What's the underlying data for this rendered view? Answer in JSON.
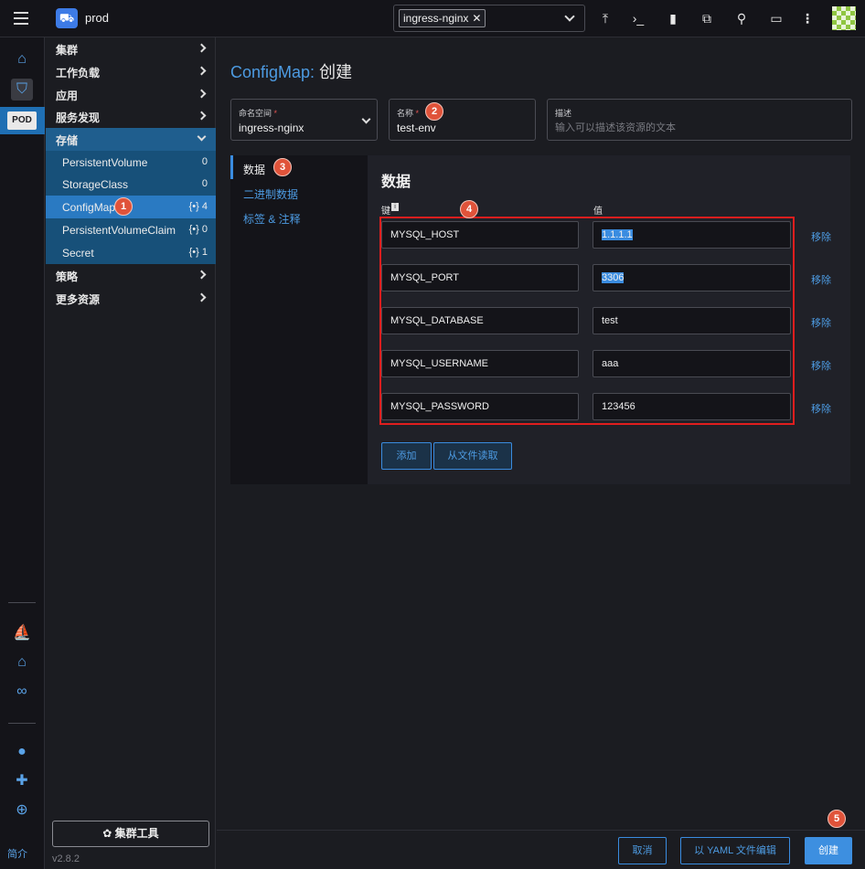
{
  "header": {
    "cluster_name": "prod",
    "namespace_tag": "ingress-nginx",
    "tag_remove": "✕",
    "icons": [
      "upload-icon",
      "terminal-icon",
      "file-icon",
      "copy-icon",
      "search-icon",
      "book-icon",
      "more-icon"
    ]
  },
  "rail": {
    "pod_label": "POD",
    "bottom_label": "简介"
  },
  "nav": {
    "groups": [
      {
        "label": "集群"
      },
      {
        "label": "工作负载"
      },
      {
        "label": "应用"
      },
      {
        "label": "服务发现"
      },
      {
        "label": "存储"
      },
      {
        "label": "策略"
      },
      {
        "label": "更多资源"
      }
    ],
    "storage_items": [
      {
        "label": "PersistentVolume",
        "count": "0"
      },
      {
        "label": "StorageClass",
        "count": "0"
      },
      {
        "label": "ConfigMap",
        "count": "{•} 4"
      },
      {
        "label": "PersistentVolumeClaim",
        "count": "{•} 0"
      },
      {
        "label": "Secret",
        "count": "{•} 1"
      }
    ],
    "cluster_tools": "✿ 集群工具",
    "version": "v2.8.2"
  },
  "main": {
    "title_resource": "ConfigMap:",
    "title_action": "创建",
    "namespace": {
      "label": "命名空间",
      "req": "*",
      "value": "ingress-nginx"
    },
    "name": {
      "label": "名称",
      "req": "*",
      "value": "test-env"
    },
    "description": {
      "label": "描述",
      "placeholder": "输入可以描述该资源的文本"
    },
    "tabs": [
      "数据",
      "二进制数据",
      "标签 & 注释"
    ],
    "section_title": "数据",
    "key_header": "键",
    "info_glyph": "i",
    "value_header": "值",
    "rows": [
      {
        "key": "MYSQL_HOST",
        "value": "1.1.1.1",
        "remove": "移除"
      },
      {
        "key": "MYSQL_PORT",
        "value": "3306",
        "remove": "移除"
      },
      {
        "key": "MYSQL_DATABASE",
        "value": "test",
        "remove": "移除"
      },
      {
        "key": "MYSQL_USERNAME",
        "value": "aaa",
        "remove": "移除"
      },
      {
        "key": "MYSQL_PASSWORD",
        "value": "123456",
        "remove": "移除"
      }
    ],
    "add_button": "添加",
    "read_file_button": "从文件读取"
  },
  "footer": {
    "cancel": "取消",
    "edit_yaml": "以 YAML 文件编辑",
    "create": "创建"
  },
  "badges": [
    "1",
    "2",
    "3",
    "4",
    "5"
  ],
  "colors": {
    "accent": "#3d8fe0",
    "badge": "#e0533a",
    "highlight_box": "#e01e1e"
  }
}
